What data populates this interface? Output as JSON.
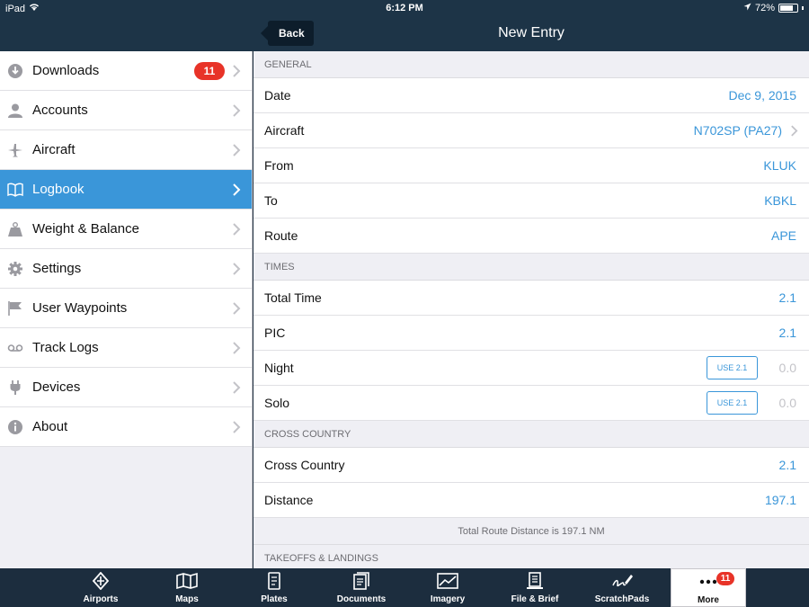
{
  "status": {
    "carrier": "iPad",
    "time": "6:12 PM",
    "battery": "72%"
  },
  "nav": {
    "back_label": "Back",
    "title": "New Entry"
  },
  "sidebar": {
    "items": [
      {
        "label": "Downloads",
        "badge": "11",
        "icon": "download-icon"
      },
      {
        "label": "Accounts",
        "icon": "user-icon"
      },
      {
        "label": "Aircraft",
        "icon": "airplane-icon"
      },
      {
        "label": "Logbook",
        "icon": "book-icon",
        "active": true
      },
      {
        "label": "Weight & Balance",
        "icon": "weight-icon"
      },
      {
        "label": "Settings",
        "icon": "gear-icon"
      },
      {
        "label": "User Waypoints",
        "icon": "flag-icon"
      },
      {
        "label": "Track Logs",
        "icon": "track-icon"
      },
      {
        "label": "Devices",
        "icon": "plug-icon"
      },
      {
        "label": "About",
        "icon": "info-icon"
      }
    ]
  },
  "main": {
    "general": {
      "header": "GENERAL",
      "date": {
        "label": "Date",
        "value": "Dec 9, 2015"
      },
      "aircraft": {
        "label": "Aircraft",
        "value": "N702SP (PA27)"
      },
      "from": {
        "label": "From",
        "value": "KLUK"
      },
      "to": {
        "label": "To",
        "value": "KBKL"
      },
      "route": {
        "label": "Route",
        "value": "APE"
      }
    },
    "times": {
      "header": "TIMES",
      "total": {
        "label": "Total Time",
        "value": "2.1"
      },
      "pic": {
        "label": "PIC",
        "value": "2.1"
      },
      "night": {
        "label": "Night",
        "button": "USE 2.1",
        "value": "0.0"
      },
      "solo": {
        "label": "Solo",
        "button": "USE 2.1",
        "value": "0.0"
      }
    },
    "cross_country": {
      "header": "CROSS COUNTRY",
      "xc": {
        "label": "Cross Country",
        "value": "2.1"
      },
      "distance": {
        "label": "Distance",
        "value": "197.1"
      },
      "note": "Total Route Distance is 197.1 NM"
    },
    "takeoffs": {
      "header": "TAKEOFFS & LANDINGS"
    }
  },
  "tabbar": {
    "items": [
      {
        "label": "Airports",
        "icon": "airport-icon"
      },
      {
        "label": "Maps",
        "icon": "map-icon"
      },
      {
        "label": "Plates",
        "icon": "plate-icon"
      },
      {
        "label": "Documents",
        "icon": "documents-icon"
      },
      {
        "label": "Imagery",
        "icon": "imagery-icon"
      },
      {
        "label": "File & Brief",
        "icon": "file-brief-icon"
      },
      {
        "label": "ScratchPads",
        "icon": "scratchpad-icon"
      },
      {
        "label": "More",
        "icon": "more-icon",
        "badge": "11",
        "active": true
      }
    ]
  },
  "colors": {
    "accent": "#3a96d9",
    "nav_bg": "#1d3447",
    "badge": "#e83328"
  }
}
